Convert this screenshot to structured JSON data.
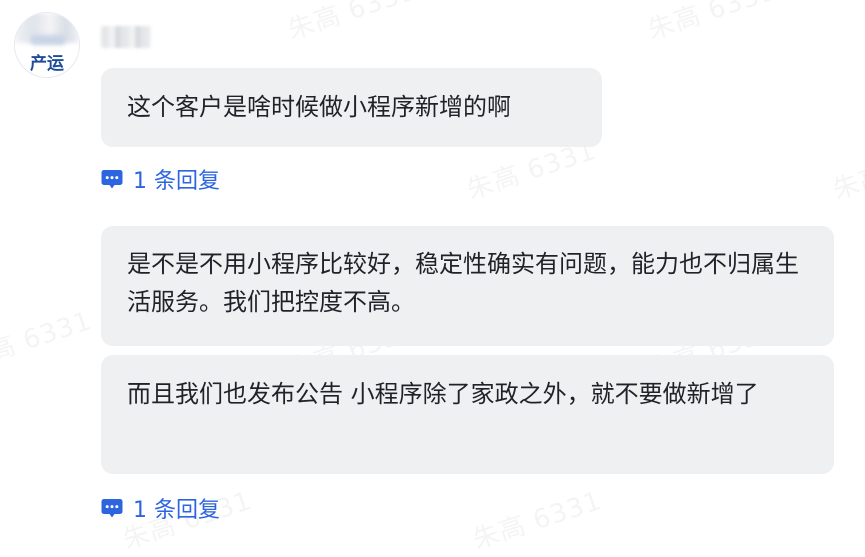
{
  "watermark": {
    "text": "朱高 6331"
  },
  "message_group": {
    "avatar_text": "产运",
    "messages": [
      {
        "text": "这个客户是啥时候做小程序新增的啊"
      },
      {
        "text": "是不是不用小程序比较好，稳定性确实有问题，能力也不归属生活服务。我们把控度不高。"
      },
      {
        "text": "而且我们也发布公告 小程序除了家政之外，就不要做新增了"
      }
    ],
    "replies": [
      {
        "label": "1 条回复",
        "icon": "comment-bubble-icon"
      },
      {
        "label": "1 条回复",
        "icon": "comment-bubble-icon"
      }
    ]
  },
  "colors": {
    "bubble_bg": "#eff0f1",
    "link": "#2d65e0",
    "avatar_text": "#1e4c9a"
  }
}
